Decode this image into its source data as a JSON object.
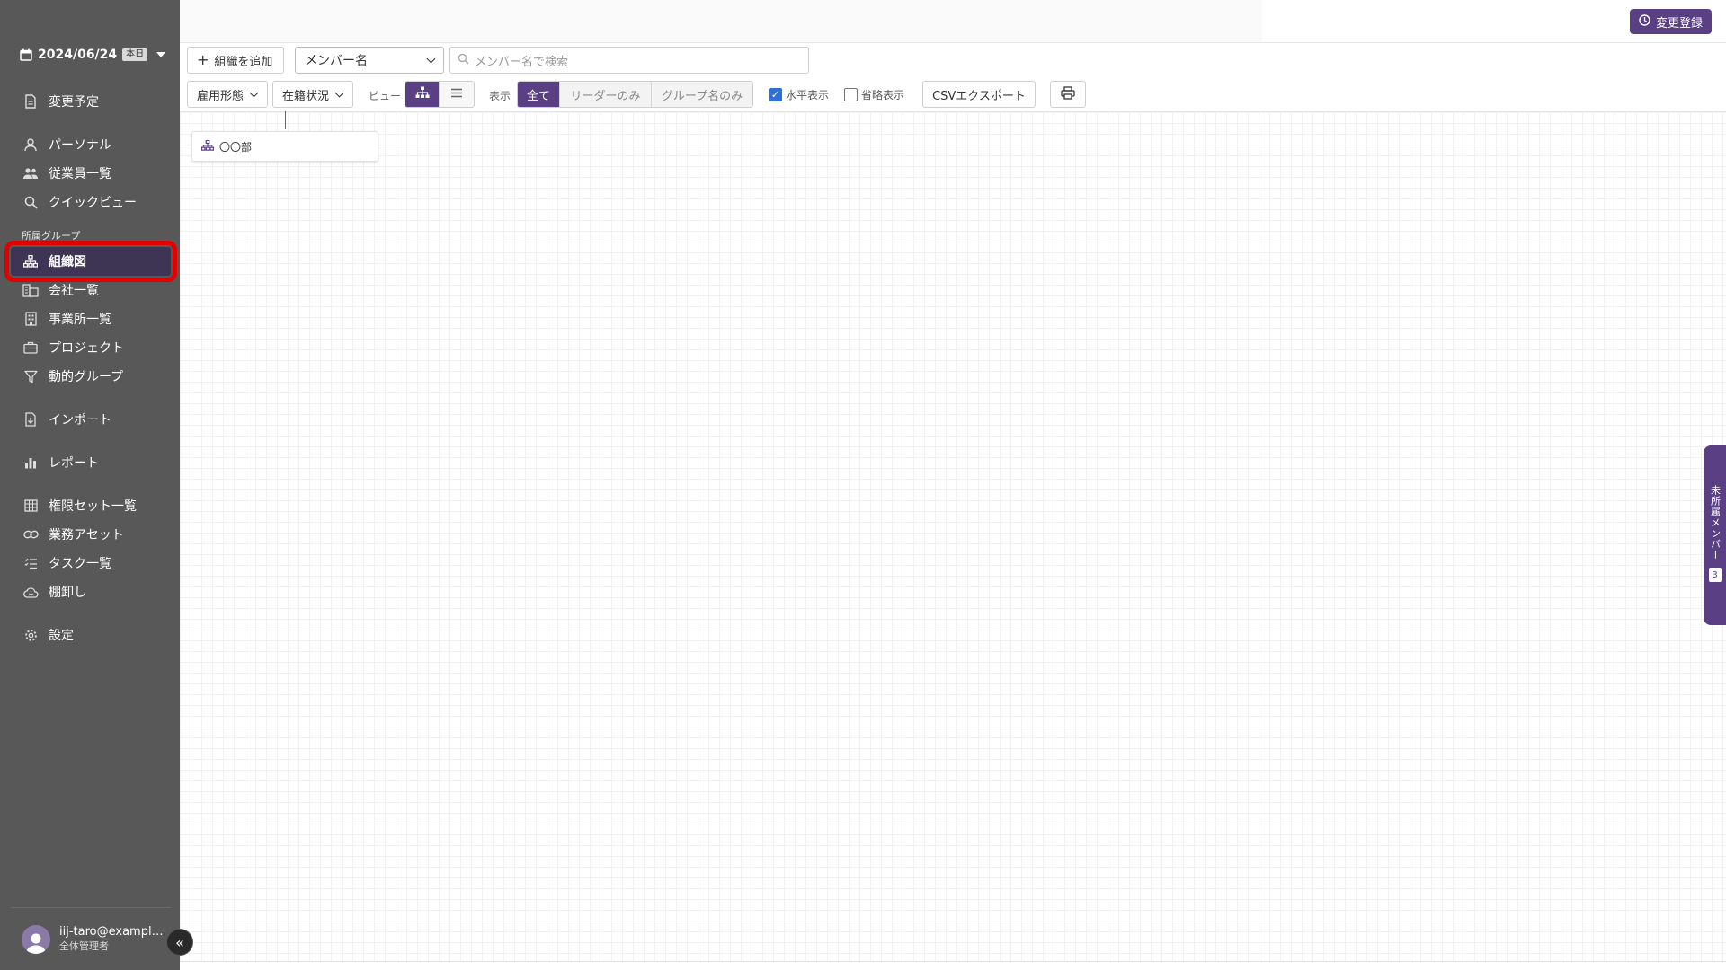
{
  "sidebar": {
    "date": "2024/06/24",
    "today_badge": "本日",
    "section_label": "所属グループ",
    "items": [
      {
        "label": "変更予定",
        "icon": "document-icon"
      },
      {
        "label": "パーソナル",
        "icon": "person-icon"
      },
      {
        "label": "従業員一覧",
        "icon": "people-icon"
      },
      {
        "label": "クイックビュー",
        "icon": "search-icon"
      },
      {
        "label": "組織図",
        "icon": "org-chart-icon"
      },
      {
        "label": "会社一覧",
        "icon": "buildings-icon"
      },
      {
        "label": "事業所一覧",
        "icon": "office-icon"
      },
      {
        "label": "プロジェクト",
        "icon": "briefcase-icon"
      },
      {
        "label": "動的グループ",
        "icon": "filter-icon"
      },
      {
        "label": "インポート",
        "icon": "import-icon"
      },
      {
        "label": "レポート",
        "icon": "bar-chart-icon"
      },
      {
        "label": "権限セット一覧",
        "icon": "grid-icon"
      },
      {
        "label": "業務アセット",
        "icon": "link-icon"
      },
      {
        "label": "タスク一覧",
        "icon": "task-list-icon"
      },
      {
        "label": "棚卸し",
        "icon": "cloud-icon"
      },
      {
        "label": "設定",
        "icon": "gear-icon"
      }
    ],
    "active_item": "組織図",
    "user": {
      "email": "iij-taro@example...",
      "role": "全体管理者"
    }
  },
  "topbar": {
    "register_label": "変更登録"
  },
  "toolbar": {
    "add_org_label": "組織を追加",
    "member_select_value": "メンバー名",
    "search_placeholder": "メンバー名で検索",
    "employment_type_label": "雇用形態",
    "status_label": "在籍状況",
    "view_label": "ビュー",
    "display_label": "表示",
    "display_options": [
      "全て",
      "リーダーのみ",
      "グループ名のみ"
    ],
    "display_selected": "全て",
    "horizontal_label": "水平表示",
    "horizontal_checked": true,
    "abbrev_label": "省略表示",
    "abbrev_checked": false,
    "csv_label": "CSVエクスポート"
  },
  "canvas": {
    "node_label": "〇〇部"
  },
  "side_tab": {
    "label": "未所属メンバー",
    "count": "3"
  },
  "colors": {
    "accent": "#5a3f85",
    "sidebar": "#585858",
    "highlight": "#e00000"
  }
}
